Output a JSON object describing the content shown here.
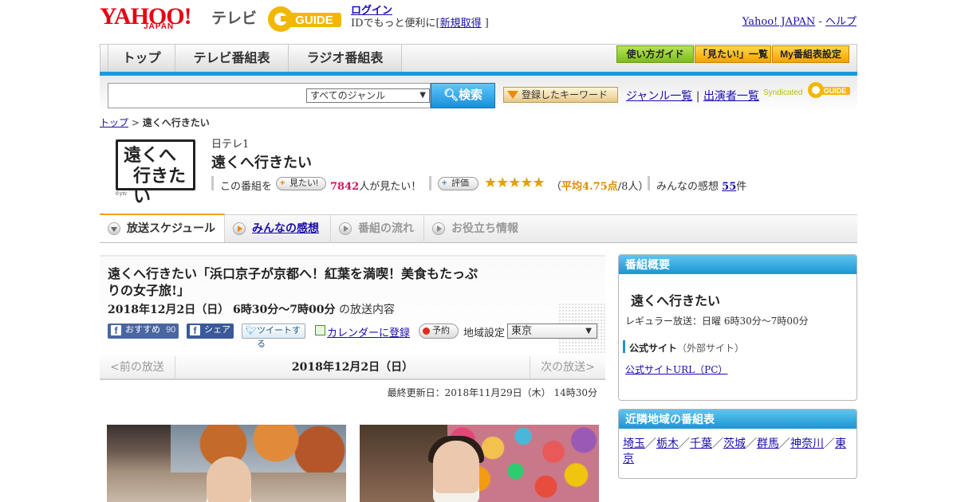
{
  "header": {
    "logo_yahoo": "YAHOO!",
    "logo_japan": "JAPAN",
    "logo_tv": "テレビ",
    "logo_gguide": "GUIDE",
    "login": "ログイン",
    "login_note_prefix": "IDでもっと便利に[",
    "signup": "新規取得",
    "login_note_suffix": "]",
    "yahoo_japan_link": "Yahoo! JAPAN",
    "link_sep": " - ",
    "help_link": "ヘルプ"
  },
  "nav": {
    "tabs": [
      "トップ",
      "テレビ番組表",
      "ラジオ番組表"
    ],
    "buttons": [
      "使い方ガイド",
      "「見たい!」一覧",
      "My番組表設定"
    ]
  },
  "search": {
    "genre_selected": "すべてのジャンル",
    "search_button": "検索",
    "keyword_button": "登録したキーワード",
    "genre_list_link": "ジャンル一覧",
    "link_divider": "|",
    "performer_list_link": "出演者一覧",
    "syndicated": "Syndicated"
  },
  "breadcrumb": {
    "top": "トップ",
    "sep": ">",
    "current": "遠くへ行きたい"
  },
  "program": {
    "logo_text_line1": "遠くへ",
    "logo_text_line2": "行きたい",
    "logo_credit": "©ytv",
    "channel": "日テレ1",
    "title": "遠くへ行きたい",
    "want_prefix": "この番組を",
    "want_button": "見たい!",
    "want_count": "7842",
    "want_suffix": "人が見たい！",
    "rate_button": "評価",
    "stars": "★★★★★",
    "rating_open": "（",
    "rating_label": "平均4.75点",
    "rating_count": "/8人）",
    "comments_label": "みんなの感想",
    "comments_count": "55",
    "comments_suffix": "件"
  },
  "content_tabs": [
    "放送スケジュール",
    "みんなの感想",
    "番組の流れ",
    "お役立ち情報"
  ],
  "episode": {
    "title": "遠くへ行きたい「浜口京子が京都へ！紅葉を満喫！美食もたっぷりの女子旅!」",
    "date_bold": "2018年12月2日（日） 6時30分～7時00分",
    "date_suffix": "の放送内容",
    "fb_like": "おすすめ",
    "fb_like_count": "90",
    "fb_share": "シェア",
    "tweet": "ツイートする",
    "calendar": "カレンダーに登録",
    "reserve": "予約",
    "region_label": "地域設定",
    "region_selected": "東京"
  },
  "pager": {
    "prev": "<前の放送",
    "date": "2018年12月2日（日）",
    "next": "次の放送>"
  },
  "updated": "最終更新日：2018年11月29日（木） 14時30分",
  "sidebar": {
    "overview_title": "番組概要",
    "program_name": "遠くへ行きたい",
    "regular": "レギュラー放送：日曜 6時30分～7時00分",
    "official_site": "公式サイト",
    "official_site_note": "（外部サイト）",
    "official_url": "公式サイトURL（PC）",
    "nearby_title": "近隣地域の番組表",
    "nearby": [
      "埼玉",
      "栃木",
      "千葉",
      "茨城",
      "群馬",
      "神奈川",
      "東京"
    ],
    "nearby_sep": "／"
  },
  "colors": {
    "accent_blue": "#1a96d2",
    "link": "#1a0dab",
    "want_count": "#d4145a",
    "rating": "#e08a00"
  }
}
